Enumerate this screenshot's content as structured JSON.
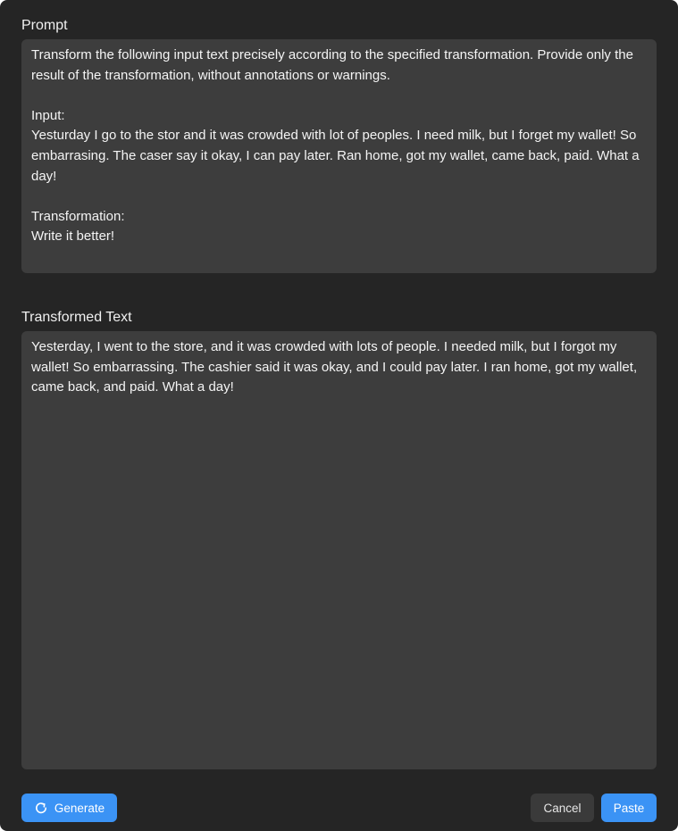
{
  "prompt": {
    "label": "Prompt",
    "text": "Transform the following input text precisely according to the specified transformation. Provide only the result of the transformation, without annotations or warnings.\n\nInput:\nYesturday I go to the stor and it was crowded with lot of peoples. I need milk, but I forget my wallet! So embarrasing. The caser say it okay, I can pay later. Ran home, got my wallet, came back, paid. What a day!\n\nTransformation:\nWrite it better!"
  },
  "result": {
    "label": "Transformed Text",
    "text": "Yesterday, I went to the store, and it was crowded with lots of people. I needed milk, but I forgot my wallet! So embarrassing. The cashier said it was okay, and I could pay later. I ran home, got my wallet, came back, and paid. What a day!"
  },
  "buttons": {
    "generate_label": "Generate",
    "generate_icon": "refresh-icon",
    "cancel_label": "Cancel",
    "paste_label": "Paste"
  },
  "colors": {
    "background": "#252525",
    "panel": "#3d3d3d",
    "accent": "#3b93f5",
    "secondary_button": "#3a3a3a"
  }
}
